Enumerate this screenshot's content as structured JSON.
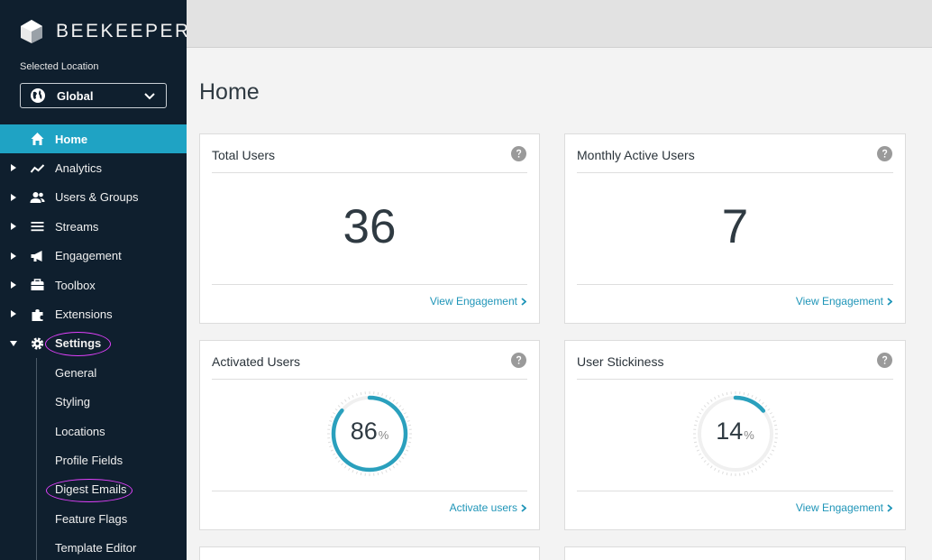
{
  "brand": {
    "name": "BEEKEEPER"
  },
  "location": {
    "label": "Selected Location",
    "value": "Global"
  },
  "nav": {
    "items": [
      {
        "label": "Home",
        "icon": "home-icon",
        "active": true,
        "expandable": false
      },
      {
        "label": "Analytics",
        "icon": "chart-line-icon",
        "expandable": true
      },
      {
        "label": "Users & Groups",
        "icon": "users-icon",
        "expandable": true
      },
      {
        "label": "Streams",
        "icon": "list-icon",
        "expandable": true
      },
      {
        "label": "Engagement",
        "icon": "megaphone-icon",
        "expandable": true
      },
      {
        "label": "Toolbox",
        "icon": "toolbox-icon",
        "expandable": true
      },
      {
        "label": "Extensions",
        "icon": "puzzle-icon",
        "expandable": true
      },
      {
        "label": "Settings",
        "icon": "gear-icon",
        "expandable": true,
        "expanded": true
      }
    ],
    "settings_sub": [
      "General",
      "Styling",
      "Locations",
      "Profile Fields",
      "Digest Emails",
      "Feature Flags",
      "Template Editor"
    ]
  },
  "page": {
    "title": "Home"
  },
  "cards": {
    "total_users": {
      "title": "Total Users",
      "value": "36",
      "link": "View Engagement"
    },
    "monthly_active": {
      "title": "Monthly Active Users",
      "value": "7",
      "link": "View Engagement"
    },
    "activated": {
      "title": "Activated Users",
      "value": "86",
      "unit": "%",
      "percent": 86,
      "link": "Activate users"
    },
    "stickiness": {
      "title": "User Stickiness",
      "value": "14",
      "unit": "%",
      "percent": 14,
      "link": "View Engagement"
    }
  },
  "colors": {
    "sidebar": "#0f1f2e",
    "accent": "#1fa3c4",
    "gauge": "#2aa0bd",
    "annotation": "#e040fb"
  }
}
